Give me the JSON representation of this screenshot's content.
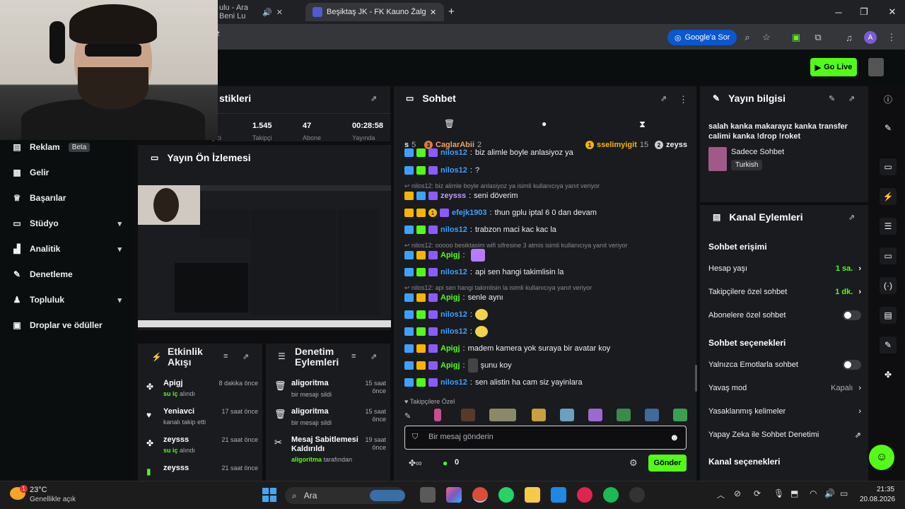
{
  "browser": {
    "tab1_title": "ulu - Ara Beni Lu",
    "tab2_title": "Beşiktaş JK - FK Kauno Žalgiris",
    "new_tab": "+",
    "google_sor": "Google'a Sor",
    "profile_letter": "A"
  },
  "topbar": {
    "go_live": "Go Live"
  },
  "sidebar": {
    "items": [
      {
        "label": "Reklam",
        "badge": "Beta"
      },
      {
        "label": "Gelir"
      },
      {
        "label": "Başarılar"
      },
      {
        "label": "Stüdyo"
      },
      {
        "label": "Analitik"
      },
      {
        "label": "Denetleme"
      },
      {
        "label": "Topluluk"
      },
      {
        "label": "Droplar ve ödüller"
      }
    ]
  },
  "stats": {
    "title": "stikleri",
    "values": [
      "1.545",
      "47",
      "00:28:58"
    ],
    "labels": [
      "İzleyici",
      "Takipçi",
      "Abone",
      "Yayında"
    ]
  },
  "preview": {
    "title": "Yayın Ön İzlemesi"
  },
  "activity": {
    "title": "Etkinlik Akışı",
    "items": [
      {
        "name": "Apigj",
        "time": "8 dakika önce",
        "desc_bold": "su iç",
        "desc": " alındı"
      },
      {
        "name": "Yeniavci",
        "time": "17 saat önce",
        "desc_bold": "",
        "desc": "kanalı takip etti"
      },
      {
        "name": "zeysss",
        "time": "21 saat önce",
        "desc_bold": "su iç",
        "desc": " alındı"
      },
      {
        "name": "zeysss",
        "time": "21 saat önce",
        "desc_bold": "",
        "desc": ""
      }
    ]
  },
  "modlog": {
    "title": "Denetim Eylemleri",
    "items": [
      {
        "name": "aligoritma",
        "time": "15 saat önce",
        "desc_bold": "",
        "desc": "bir mesajı sildi"
      },
      {
        "name": "aligoritma",
        "time": "15 saat önce",
        "desc_bold": "",
        "desc": "bir mesajı sildi"
      },
      {
        "name": "Mesaj Sabitlemesi Kaldırıldı",
        "time": "19 saat önce",
        "desc_bold": "aligoritma",
        "desc": " tarafından"
      }
    ]
  },
  "chat": {
    "title": "Sohbet",
    "top_users": [
      {
        "name": "s",
        "count": "5"
      },
      {
        "rank": "3",
        "name": "CaglarAbii",
        "count": "2"
      },
      {
        "rank": "1",
        "name": "sselimyigit",
        "count": "15"
      },
      {
        "rank": "2",
        "name": "zeyss",
        "count": ""
      }
    ],
    "messages": [
      {
        "user": "nilos12",
        "text": "biz alimle boyle anlasiyoz ya"
      },
      {
        "user": "nilos12",
        "text": "?"
      },
      {
        "reply": "nilos12: biz alimle boyle anlasiyoz ya isimli kullanıcıya yanıt veriyor"
      },
      {
        "user": "zeysss",
        "text": "seni döverim"
      },
      {
        "user": "efejk1903",
        "text": "thun gplu iptal 6 0 dan devam"
      },
      {
        "user": "nilos12",
        "text": "trabzon maci kac kac la"
      },
      {
        "reply": "nilos12: ooooo besiktasim wifi sifresine 3 atmis isimli kullanıcıya yanıt veriyor"
      },
      {
        "user": "Apigj",
        "text": ""
      },
      {
        "user": "nilos12",
        "text": "api sen hangi takimlisin la"
      },
      {
        "reply": "nilos12: api sen hangi takimlisin la isimli kullanıcıya yanıt veriyor"
      },
      {
        "user": "Apigj",
        "text": "senle aynı"
      },
      {
        "user": "nilos12",
        "text": ""
      },
      {
        "user": "nilos12",
        "text": ""
      },
      {
        "user": "Apigj",
        "text": "madem kamera yok suraya bir avatar koy"
      },
      {
        "user": "Apigj",
        "text": "şunu koy"
      },
      {
        "user": "nilos12",
        "text": "sen alistin ha cam siz yayinlara"
      }
    ],
    "followers_special": "Takipçilere Özel",
    "input_placeholder": "Bir mesaj gönderin",
    "points": "0",
    "send": "Gönder"
  },
  "stream_info": {
    "title": "Yayın bilgisi",
    "stream_title": "salah kanka makarayız kanka transfer calimi kanka !drop !roket",
    "category": "Sadece Sohbet",
    "language": "Turkish"
  },
  "channel_actions": {
    "title": "Kanal Eylemleri",
    "chat_access": "Sohbet erişimi",
    "account_age_label": "Hesap yaşı",
    "account_age_value": "1 sa.",
    "followers_only_label": "Takipçilere özel sohbet",
    "followers_only_value": "1 dk.",
    "subs_only_label": "Abonelere özel sohbet",
    "chat_options": "Sohbet seçenekleri",
    "emote_only_label": "Yalnızca Emotlarla sohbet",
    "slow_mode_label": "Yavaş mod",
    "slow_mode_value": "Kapalı",
    "banned_words_label": "Yasaklanmış kelimeler",
    "ai_mod_label": "Yapay Zeka ile Sohbet Denetimi",
    "channel_options": "Kanal seçenekleri"
  },
  "taskbar": {
    "temp": "23°C",
    "weather": "Genellikle açık",
    "weather_badge": "1",
    "search": "Ara",
    "time": "21:35",
    "date": "20.08.2026"
  },
  "colors": {
    "accent": "#53fc18",
    "panel": "#191b1f",
    "bg": "#0e0e10"
  }
}
